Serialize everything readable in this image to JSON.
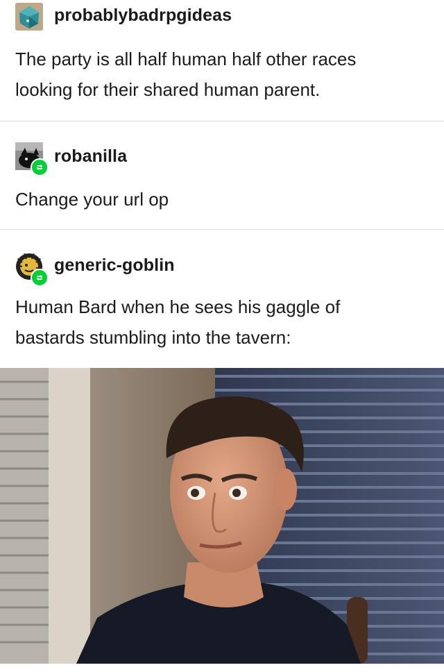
{
  "posts": [
    {
      "username": "probablybadrpgideas",
      "text_lines": [
        "The party is all half human  half other races",
        "looking for their shared human parent."
      ],
      "avatar_icon": "dice-icon",
      "reblog": false
    },
    {
      "username": "robanilla",
      "text_lines": [
        "Change your url op"
      ],
      "avatar_icon": "dark-creature-avatar",
      "reblog": true
    },
    {
      "username": "generic-goblin",
      "text_lines": [
        "Human Bard when he sees his gaggle of",
        "bastards stumbling into the tavern:"
      ],
      "avatar_icon": "goblin-sun-avatar",
      "reblog": true
    }
  ],
  "reblog_icon": "reblog-icon",
  "colors": {
    "reblog_green": "#00cf35",
    "divider": "#dcdcdc"
  },
  "image": {
    "icon": "reaction-photo"
  }
}
